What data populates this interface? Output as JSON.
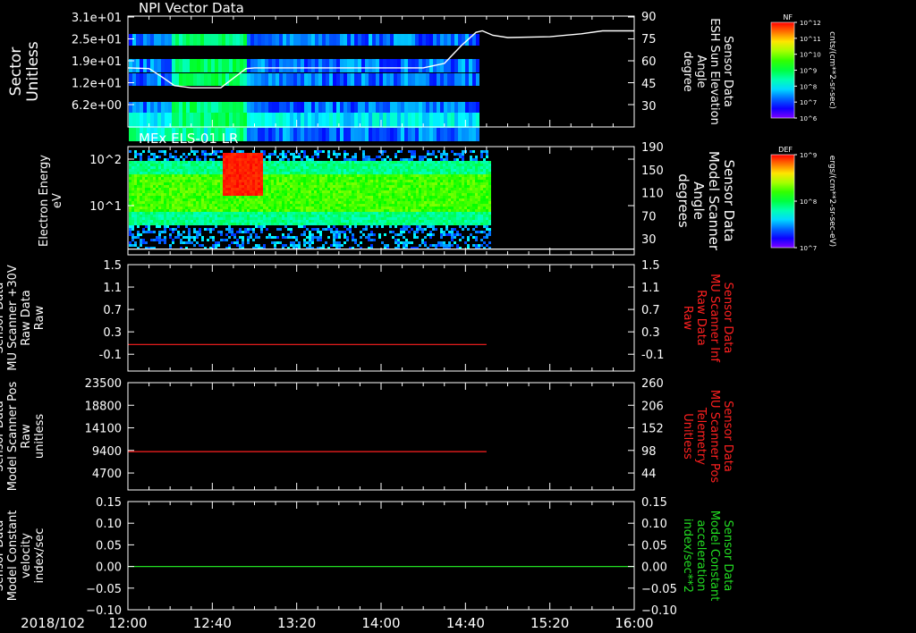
{
  "date_label": "2018/102",
  "time_axis": {
    "range": [
      "12:00",
      "16:00"
    ],
    "ticks": [
      "12:00",
      "12:40",
      "13:20",
      "14:00",
      "14:40",
      "15:20",
      "16:00"
    ],
    "data_end": "14:50"
  },
  "colors": {
    "background": "#000000",
    "axes": "#ffffff",
    "red_trace": "#ff2020",
    "green_trace": "#22dd22",
    "right_red_label": "#ff2020",
    "right_green_label": "#22dd22"
  },
  "chart_data": [
    {
      "type": "heatmap",
      "title": "NPI Vector Data",
      "ylabel": [
        "Sector",
        "Unitless"
      ],
      "yticks": [
        "3.1e+01",
        "2.5e+01",
        "1.9e+01",
        "1.2e+01",
        "6.2e+00"
      ],
      "y2label": [
        "Sensor Data",
        "ESH Sun Elevation",
        "Angle",
        "degree"
      ],
      "y2ticks": [
        "90",
        "75",
        "60",
        "45",
        "30"
      ],
      "y2lim": [
        15,
        90
      ],
      "overlay_line": {
        "color": "#ffffff",
        "points": [
          [
            "12:00",
            55
          ],
          [
            "12:10",
            54.5
          ],
          [
            "12:16",
            49
          ],
          [
            "12:22",
            43
          ],
          [
            "12:30",
            41.5
          ],
          [
            "12:44",
            41.5
          ],
          [
            "12:50",
            48
          ],
          [
            "12:56",
            54.5
          ],
          [
            "13:00",
            55
          ],
          [
            "14:20",
            55
          ],
          [
            "14:30",
            58
          ],
          [
            "14:38",
            70
          ],
          [
            "14:45",
            79
          ],
          [
            "14:48",
            80
          ],
          [
            "14:53",
            77
          ],
          [
            "15:00",
            75.5
          ],
          [
            "15:20",
            76
          ],
          [
            "15:35",
            78
          ],
          [
            "15:45",
            80
          ],
          [
            "16:00",
            80
          ]
        ]
      },
      "colorbar": {
        "label": "NF",
        "ticks": [
          "10^12",
          "10^11",
          "10^10",
          "10^9",
          "10^8",
          "10^7",
          "10^6"
        ],
        "units": "cnts/(cm**2-sr-sec)"
      }
    },
    {
      "type": "heatmap",
      "title": "MEx ELS-01 LR",
      "ylabel": [
        "Electron Energy",
        "eV"
      ],
      "yticks": [
        "10^2",
        "10^1"
      ],
      "y2label": [
        "Sensor Data",
        "Model Scanner",
        "Angle",
        "degrees"
      ],
      "y2ticks": [
        "190",
        "150",
        "110",
        "70",
        "30"
      ],
      "y2lim": [
        0,
        190
      ],
      "overlay_line": {
        "color": "#ffffff",
        "points": [
          [
            "12:00",
            10
          ],
          [
            "16:00",
            10
          ]
        ]
      },
      "colorbar": {
        "label": "DEF",
        "ticks": [
          "10^9",
          "10^8",
          "10^7"
        ],
        "units": "ergs/(cm**2-sr-sec-eV)"
      }
    },
    {
      "type": "line",
      "ylabel": [
        "Sensor Data",
        "MU Scanner +30V",
        "Raw Data",
        "Raw"
      ],
      "yticks": [
        "1.5",
        "1.1",
        "0.7",
        "0.3",
        "-0.1"
      ],
      "ylim": [
        -0.5,
        1.5
      ],
      "y2label": [
        "Sensor Data",
        "MU Scanner Inf",
        "Raw Data",
        "Raw"
      ],
      "y2ticks": [
        "1.5",
        "1.1",
        "0.7",
        "0.3",
        "-0.1"
      ],
      "series": [
        {
          "color": "#ff2020",
          "points": [
            [
              "12:00",
              0.0
            ],
            [
              "14:50",
              0.0
            ]
          ]
        }
      ]
    },
    {
      "type": "line",
      "ylabel": [
        "Sensor Data",
        "Model Scanner Pos",
        "Raw",
        "unitless"
      ],
      "yticks": [
        "23500",
        "18800",
        "14100",
        "9400",
        "4700"
      ],
      "ylim": [
        0,
        23500
      ],
      "y2label": [
        "Sensor Data",
        "MU Scanner Pos",
        "Telemetry",
        "Unitless"
      ],
      "y2ticks": [
        "260",
        "206",
        "152",
        "98",
        "44"
      ],
      "series": [
        {
          "color": "#ff2020",
          "points": [
            [
              "12:00",
              8400
            ],
            [
              "14:50",
              8400
            ]
          ]
        }
      ]
    },
    {
      "type": "line",
      "ylabel": [
        "Sensor Data",
        "Model Constant",
        "velocity",
        "index/sec"
      ],
      "yticks": [
        "0.15",
        "0.10",
        "0.05",
        "0.00",
        "−0.05",
        "−0.10"
      ],
      "ylim": [
        -0.1,
        0.15
      ],
      "y2label": [
        "Sensor Data",
        "Model Constant",
        "acceleration",
        "index/sec**2"
      ],
      "y2ticks": [
        "0.15",
        "0.10",
        "0.05",
        "0.00",
        "−0.05",
        "−0.10"
      ],
      "series": [
        {
          "color": "#22dd22",
          "points": [
            [
              "12:00",
              0.0
            ],
            [
              "16:00",
              0.0
            ]
          ]
        }
      ]
    }
  ]
}
